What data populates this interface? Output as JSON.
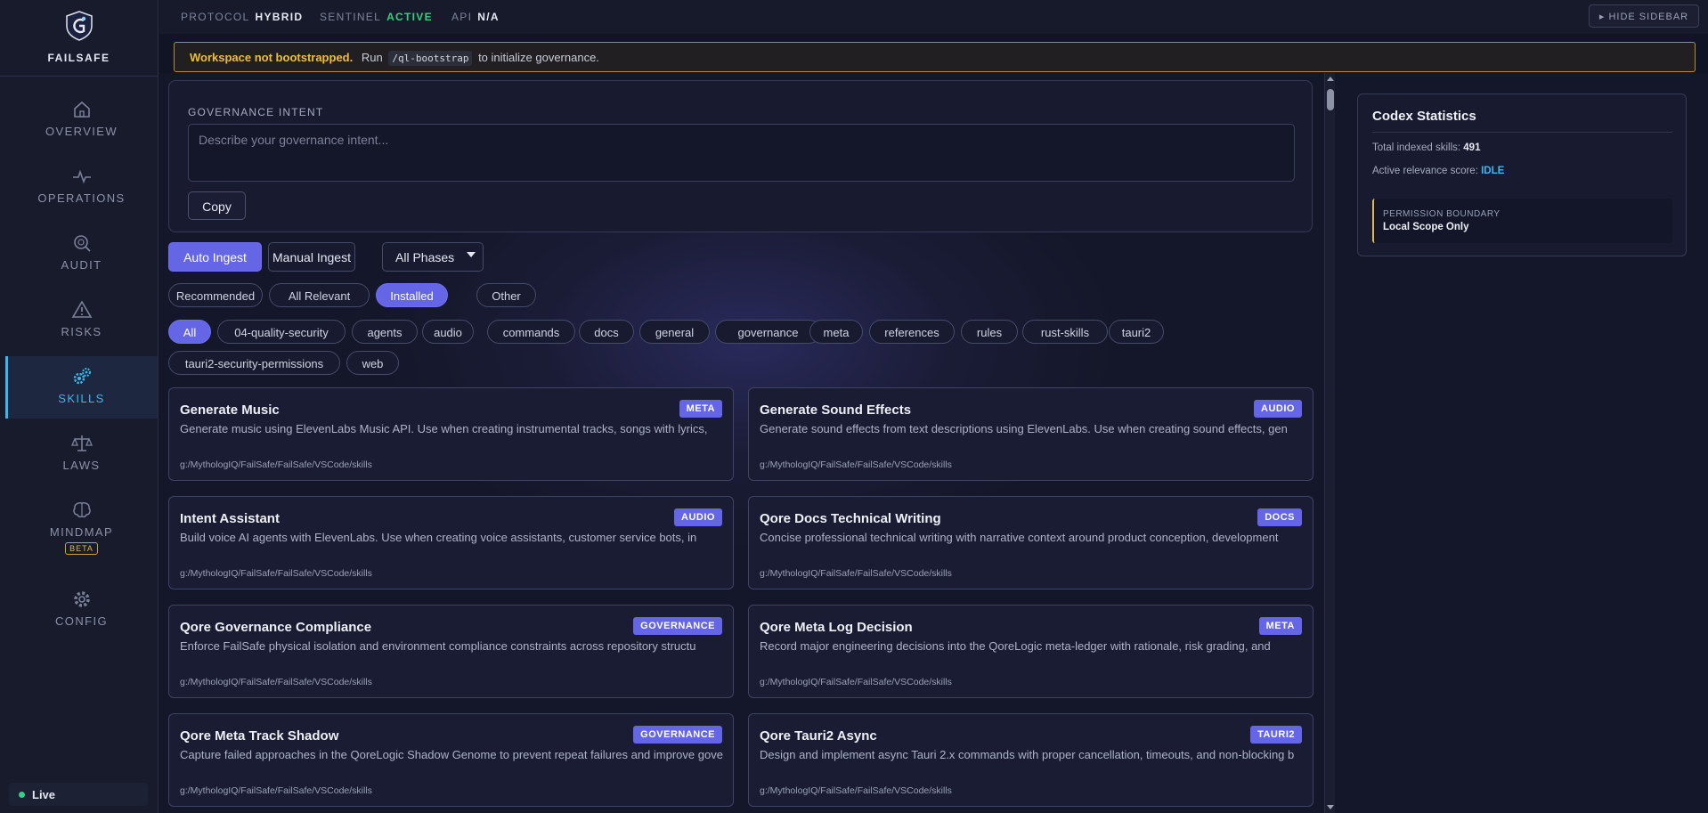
{
  "brand": {
    "name": "FAILSAFE"
  },
  "nav": {
    "items": [
      {
        "label": "OVERVIEW",
        "icon": "home-icon"
      },
      {
        "label": "OPERATIONS",
        "icon": "pulse-icon"
      },
      {
        "label": "AUDIT",
        "icon": "magnifier-icon"
      },
      {
        "label": "RISKS",
        "icon": "warning-icon"
      },
      {
        "label": "SKILLS",
        "icon": "gears-icon",
        "active": true
      },
      {
        "label": "LAWS",
        "icon": "scales-icon"
      },
      {
        "label": "MINDMAP",
        "icon": "brain-icon",
        "badge": "BETA"
      },
      {
        "label": "CONFIG",
        "icon": "gear-icon"
      }
    ],
    "live_label": "Live"
  },
  "topbar": {
    "protocol_label": "PROTOCOL",
    "protocol_value": "HYBRID",
    "sentinel_label": "SENTINEL",
    "sentinel_value": "ACTIVE",
    "api_label": "API",
    "api_value": "N/A",
    "hide_sidebar": "▸ HIDE SIDEBAR"
  },
  "banner": {
    "title": "Workspace not bootstrapped.",
    "pre": "Run",
    "command": "/ql-bootstrap",
    "post": "to initialize governance."
  },
  "intent": {
    "label": "GOVERNANCE INTENT",
    "placeholder": "Describe your governance intent...",
    "copy_label": "Copy"
  },
  "ingest": {
    "auto_label": "Auto Ingest",
    "manual_label": "Manual Ingest",
    "phase_selected": "All Phases"
  },
  "views": [
    "Recommended",
    "All Relevant",
    "Installed",
    "Other"
  ],
  "active_view": "Installed",
  "categories": [
    "All",
    "04-quality-security",
    "agents",
    "audio",
    "commands",
    "docs",
    "general",
    "governance",
    "meta",
    "references",
    "rules",
    "rust-skills",
    "tauri2",
    "tauri2-security-permissions",
    "web"
  ],
  "active_category": "All",
  "skills": [
    {
      "title": "Generate Music",
      "tag": "META",
      "desc": "Generate music using ElevenLabs Music API. Use when creating instrumental tracks, songs with lyrics,",
      "path": "g:/MythologIQ/FailSafe/FailSafe/VSCode/skills"
    },
    {
      "title": "Generate Sound Effects",
      "tag": "AUDIO",
      "desc": "Generate sound effects from text descriptions using ElevenLabs. Use when creating sound effects, gen",
      "path": "g:/MythologIQ/FailSafe/FailSafe/VSCode/skills"
    },
    {
      "title": "Intent Assistant",
      "tag": "AUDIO",
      "desc": "Build voice AI agents with ElevenLabs. Use when creating voice assistants, customer service bots, in",
      "path": "g:/MythologIQ/FailSafe/FailSafe/VSCode/skills"
    },
    {
      "title": "Qore Docs Technical Writing",
      "tag": "DOCS",
      "desc": "Concise professional technical writing with narrative context around product conception, development",
      "path": "g:/MythologIQ/FailSafe/FailSafe/VSCode/skills"
    },
    {
      "title": "Qore Governance Compliance",
      "tag": "GOVERNANCE",
      "desc": "Enforce FailSafe physical isolation and environment compliance constraints across repository structu",
      "path": "g:/MythologIQ/FailSafe/FailSafe/VSCode/skills"
    },
    {
      "title": "Qore Meta Log Decision",
      "tag": "META",
      "desc": "Record major engineering decisions into the QoreLogic meta-ledger with rationale, risk grading, and",
      "path": "g:/MythologIQ/FailSafe/FailSafe/VSCode/skills"
    },
    {
      "title": "Qore Meta Track Shadow",
      "tag": "GOVERNANCE",
      "desc": "Capture failed approaches in the QoreLogic Shadow Genome to prevent repeat failures and improve gove",
      "path": "g:/MythologIQ/FailSafe/FailSafe/VSCode/skills"
    },
    {
      "title": "Qore Tauri2 Async",
      "tag": "TAURI2",
      "desc": "Design and implement async Tauri 2.x commands with proper cancellation, timeouts, and non-blocking b",
      "path": "g:/MythologIQ/FailSafe/FailSafe/VSCode/skills"
    }
  ],
  "stats": {
    "title": "Codex Statistics",
    "indexed_label": "Total indexed skills:",
    "indexed_value": "491",
    "relevance_label": "Active relevance score:",
    "relevance_value": "IDLE",
    "perm_label": "PERMISSION BOUNDARY",
    "perm_value": "Local Scope Only"
  },
  "colors": {
    "accent": "#6466e6",
    "active_nav": "#39b7ee",
    "ok": "#33d17f",
    "warning": "#f0bd3a"
  }
}
